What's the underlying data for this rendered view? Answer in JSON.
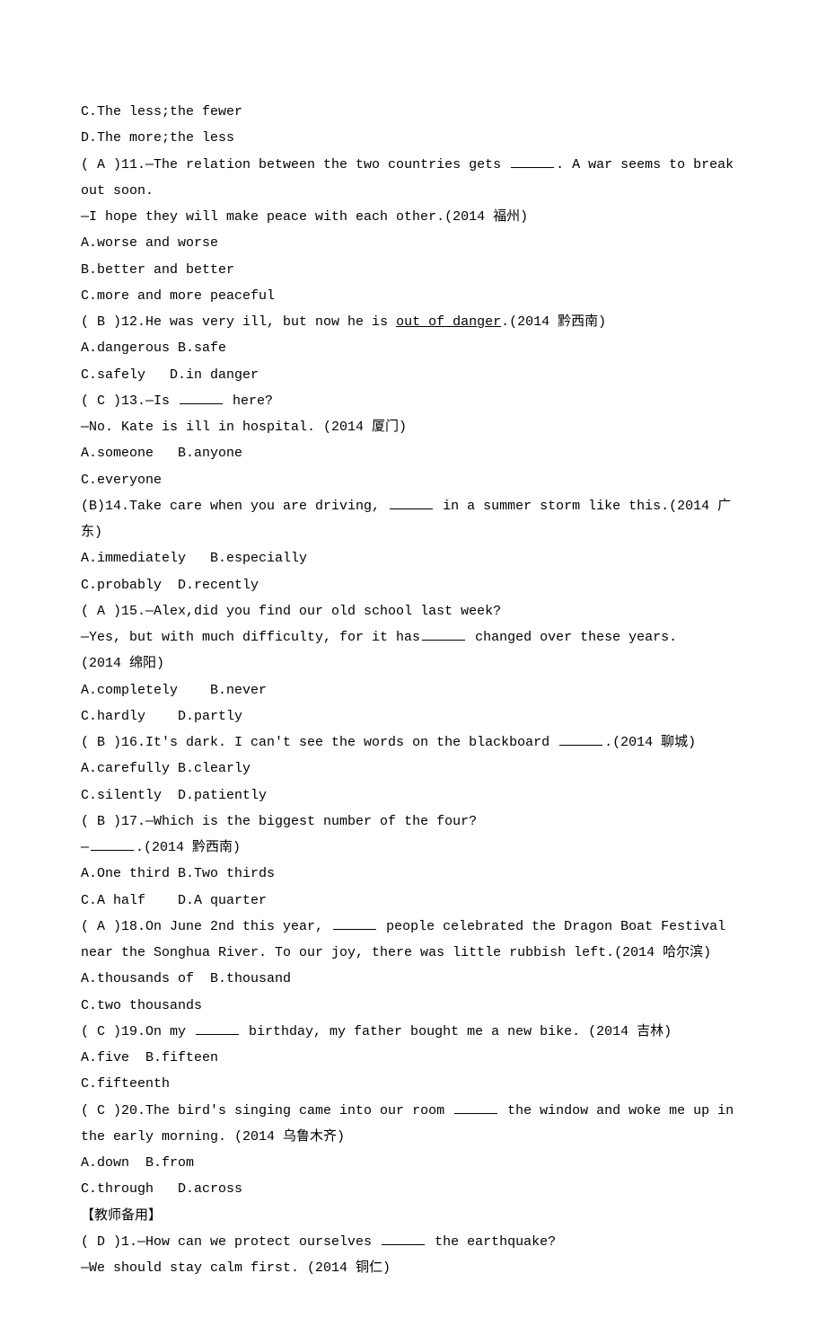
{
  "preOptions": [
    "C.The less;the fewer",
    "D.The more;the less"
  ],
  "questions": [
    {
      "number": "11",
      "answerLetter": "A",
      "stemBefore": "—The relation between the two countries gets ",
      "stemAfter": ". A war seems to break out soon.",
      "line2": "—I hope they will make peace with each other.(2014 福州)",
      "options": [
        "A.worse and worse",
        "B.better and better",
        "C.more and more peaceful"
      ],
      "inlineOptions": false,
      "hasBlank": true
    },
    {
      "number": "12",
      "answerLetter": "B",
      "stemBefore": "He was very ill, but now he is ",
      "underlined": "out of danger",
      "stemAfter": ".(2014 黔西南)",
      "options": [
        "A.dangerous B.safe",
        "C.safely   D.in danger"
      ],
      "inlineOptions": false,
      "hasBlank": false
    },
    {
      "number": "13",
      "answerLetter": "C",
      "stemBefore": "—Is ",
      "stemAfter": " here?",
      "line2": "—No. Kate is ill in hospital. (2014 厦门)",
      "options": [
        "A.someone   B.anyone",
        "C.everyone"
      ],
      "inlineOptions": false,
      "hasBlank": true
    },
    {
      "number": "14",
      "answerLetter": "B",
      "stemBefore": "Take care when you are driving, ",
      "stemAfter": " in a summer storm like this.(2014 广东)",
      "options": [
        "A.immediately   B.especially",
        "C.probably  D.recently"
      ],
      "inlineOptions": false,
      "hasBlank": true,
      "tightParen": true
    },
    {
      "number": "15",
      "answerLetter": "A",
      "stemBefore": "—Alex,did you find our old school last week?",
      "stemAfter": "",
      "line2Before": "—Yes, but with much difficulty, for it has",
      "line2After": " changed over these years.",
      "line3": "(2014 绵阳)",
      "options": [
        "A.completely    B.never",
        "C.hardly    D.partly"
      ],
      "inlineOptions": false,
      "hasBlank": false,
      "line2HasBlank": true
    },
    {
      "number": "16",
      "answerLetter": "B",
      "stemBefore": "It's dark. I can't see the words on the blackboard ",
      "stemAfter": ".(2014 聊城)",
      "options": [
        "A.carefully B.clearly",
        "C.silently  D.patiently"
      ],
      "inlineOptions": false,
      "hasBlank": true
    },
    {
      "number": "17",
      "answerLetter": "B",
      "stemBefore": "—Which is the biggest number of the four?",
      "stemAfter": "",
      "line2Before": "—",
      "line2After": ".(2014 黔西南)",
      "line2HasBlank": true,
      "options": [
        "A.One third B.Two thirds",
        "C.A half    D.A quarter"
      ],
      "inlineOptions": false,
      "hasBlank": false
    },
    {
      "number": "18",
      "answerLetter": "A",
      "stemBefore": "On June 2nd this year, ",
      "stemAfter": " people celebrated the Dragon Boat Festival near the Songhua River. To our joy, there was little rubbish left.(2014 哈尔滨)",
      "options": [
        "A.thousands of  B.thousand",
        "C.two thousands"
      ],
      "inlineOptions": false,
      "hasBlank": true
    },
    {
      "number": "19",
      "answerLetter": "C",
      "stemBefore": "On my ",
      "stemAfter": " birthday, my father bought me a new bike. (2014 吉林)",
      "options": [
        "A.five  B.fifteen",
        "C.fifteenth"
      ],
      "inlineOptions": false,
      "hasBlank": true
    },
    {
      "number": "20",
      "answerLetter": "C",
      "stemBefore": "The bird's singing came into our room ",
      "stemAfter": " the window and woke me up in the early morning. (2014 乌鲁木齐)",
      "options": [
        "A.down  B.from",
        "C.through   D.across"
      ],
      "inlineOptions": false,
      "hasBlank": true
    }
  ],
  "teacherHeader": "【教师备用】",
  "teacherQuestions": [
    {
      "number": "1",
      "answerLetter": "D",
      "stemBefore": "—How can we protect ourselves ",
      "stemAfter": " the earthquake?",
      "line2": "—We should stay calm first. (2014 铜仁)",
      "hasBlank": true
    }
  ]
}
